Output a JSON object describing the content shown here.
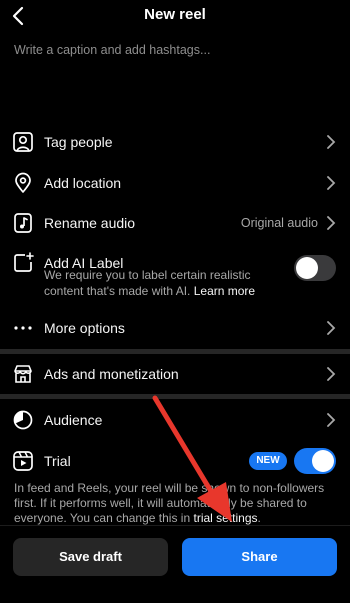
{
  "header": {
    "title": "New reel"
  },
  "caption": {
    "placeholder": "Write a caption and add hashtags..."
  },
  "rows": {
    "tag_people": "Tag people",
    "add_location": "Add location",
    "rename_audio": "Rename audio",
    "rename_audio_value": "Original audio",
    "add_ai_label": "Add AI Label",
    "ai_label_desc": "We require you to label certain realistic content that's made with AI.",
    "ai_label_link": "Learn more",
    "more_options": "More options",
    "ads": "Ads and monetization",
    "audience": "Audience",
    "trial": "Trial",
    "trial_badge": "NEW"
  },
  "toggles": {
    "ai_label_on": false,
    "trial_on": true
  },
  "trial_desc": {
    "text": "In feed and Reels, your reel will be shown to non-followers first. If it performs well, it will automatically be shared to everyone. You can change this in",
    "link": "trial settings",
    "end": "."
  },
  "buttons": {
    "save_draft": "Save draft",
    "share": "Share"
  },
  "colors": {
    "background": "#000000",
    "accent": "#1877f2",
    "secondary_button": "#262626",
    "annotation_arrow": "#e8372c"
  },
  "icons": [
    "back-icon",
    "tag-people-icon",
    "location-pin-icon",
    "rename-audio-icon",
    "ai-label-icon",
    "more-dots-icon",
    "storefront-icon",
    "audience-icon",
    "trial-icon",
    "chevron-right-icon"
  ]
}
